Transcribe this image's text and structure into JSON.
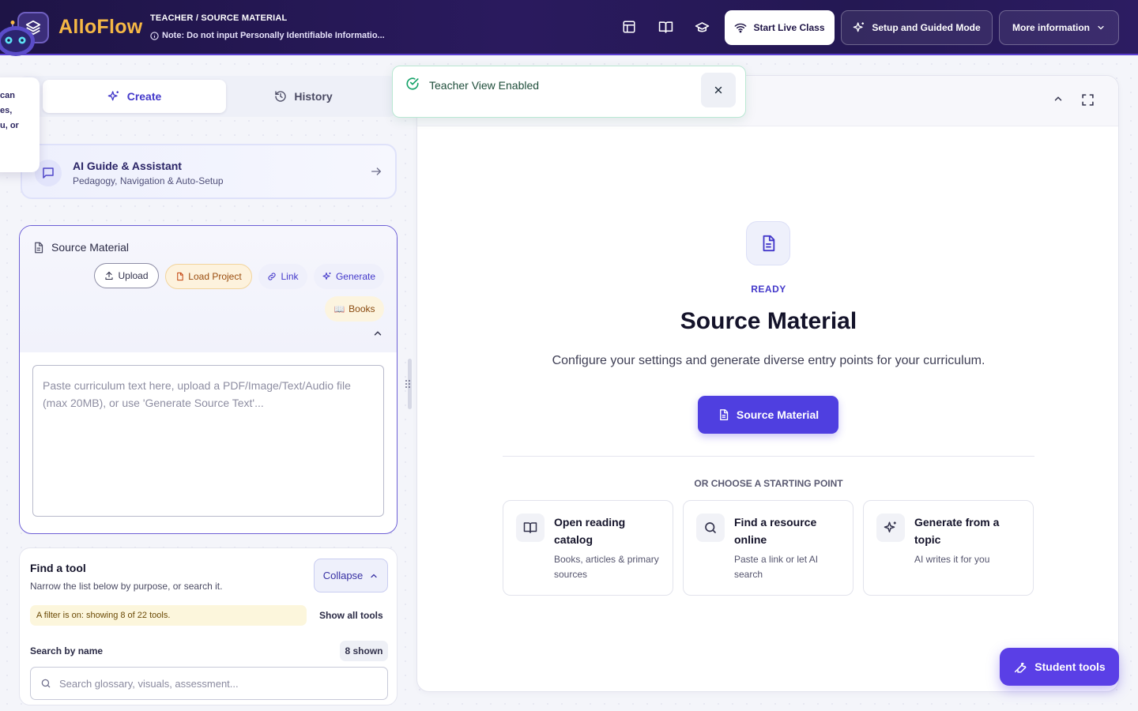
{
  "app": {
    "brand": "AlloFlow",
    "breadcrumb": "TEACHER / SOURCE MATERIAL",
    "note": "Note: Do not input Personally Identifiable Informatio..."
  },
  "header": {
    "icons": [
      "layout-icon",
      "book-open-icon",
      "graduation-cap-icon"
    ],
    "start_live_label": "Start Live Class",
    "setup_label": "Setup and Guided Mode",
    "more_info_label": "More information"
  },
  "tooltip": {
    "lines": [
      "can",
      "es,",
      "u, or"
    ]
  },
  "tabs": {
    "create_label": "Create",
    "history_label": "History"
  },
  "guide": {
    "title": "AI Guide & Assistant",
    "subtitle": "Pedagogy, Navigation & Auto-Setup"
  },
  "source": {
    "title": "Source Material",
    "upload_label": "Upload",
    "load_project_label": "Load Project",
    "link_label": "Link",
    "generate_label": "Generate",
    "books_label": "Books",
    "books_emoji": "📖",
    "textarea_placeholder": "Paste curriculum text here, upload a PDF/Image/Text/Audio file (max 20MB), or use 'Generate Source Text'..."
  },
  "find_tool": {
    "title": "Find a tool",
    "subtitle": "Narrow the list below by purpose, or search it.",
    "collapse_label": "Collapse",
    "filter_note": "A filter is on: showing 8 of 22 tools.",
    "show_all_label": "Show all tools",
    "search_label": "Search by name",
    "shown_count": "8 shown",
    "search_placeholder": "Search glossary, visuals, assessment..."
  },
  "toast": {
    "message": "Teacher View Enabled"
  },
  "main": {
    "ready_label": "READY",
    "title": "Source Material",
    "description": "Configure your settings and generate diverse entry points for your curriculum.",
    "primary_button": "Source Material",
    "or_label": "OR CHOOSE A STARTING POINT",
    "options": [
      {
        "icon": "book-open-icon",
        "title": "Open reading catalog",
        "subtitle": "Books, articles & primary sources"
      },
      {
        "icon": "search-icon",
        "title": "Find a resource online",
        "subtitle": "Paste a link or let AI search"
      },
      {
        "icon": "sparkles-icon",
        "title": "Generate from a topic",
        "subtitle": "AI writes it for you"
      }
    ]
  },
  "floating": {
    "student_tools_label": "Student tools"
  },
  "colors": {
    "accent": "#4f3fe0",
    "brand_text": "#f6b845",
    "header_bg": "#241853",
    "success": "#16a36a"
  }
}
